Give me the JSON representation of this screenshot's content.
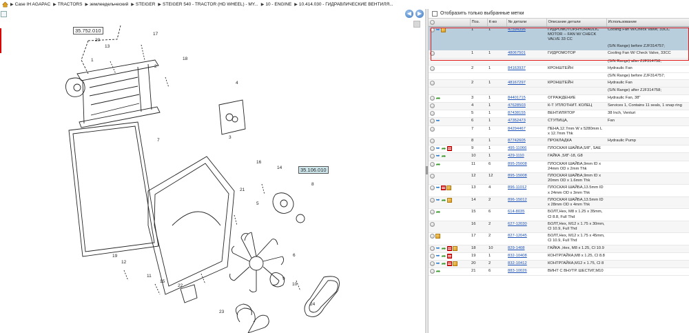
{
  "breadcrumb": [
    "Case IH AGAPAC",
    "TRACTORS",
    "землеедельческий",
    "STEIGER",
    "STEIGER 540 - TRACTOR (HD WHEEL) - MY...",
    "10 - ENGINE",
    "10.414.030 - ГИДРАВЛИЧЕСКИЕ ВЕНТИЛЯ..."
  ],
  "nav": {
    "back": "◀",
    "forward": "▶"
  },
  "filter_label": "Отобразить только выбранные метки",
  "diagram": {
    "ref_boxes": [
      "35.752.010",
      "35.106.010"
    ],
    "callouts": [
      "1",
      "2",
      "3",
      "4",
      "5",
      "6",
      "7",
      "8",
      "9",
      "10",
      "11",
      "12",
      "13",
      "14",
      "15",
      "16",
      "17",
      "18",
      "19",
      "20",
      "21",
      "22",
      "23",
      "24"
    ]
  },
  "table": {
    "headers": [
      "",
      "Поз.",
      "К-во",
      "№ детали",
      "Описание детали",
      "Использование"
    ],
    "rows": [
      {
        "icons": [
          "info",
          "arrow",
          "box"
        ],
        "pos": "1",
        "qty": "1",
        "part": "47594396",
        "desc": "ГИДРОМОТОР,HYDRAULIC MOTOR -- FAN W/ CHECK VALVE 33 CC",
        "usage": "Cooling Fan W/Check Valve, 33CC",
        "selected": true
      },
      {
        "sub": true,
        "usage": "(S/N Range) before ZJF314757;",
        "selected": true
      },
      {
        "icons": [
          "info"
        ],
        "pos": "1",
        "qty": "1",
        "part": "48067501",
        "desc": "ГИДРОМОТОР",
        "usage": "Cooling Fan W/ Check Valve, 33CC",
        "alt": true
      },
      {
        "sub": true,
        "usage": "(S/N Range) after ZJF314758;",
        "alt": true
      },
      {
        "icons": [
          "info"
        ],
        "pos": "2",
        "qty": "1",
        "part": "84163937",
        "desc": "КРОНШТЕЙН",
        "usage": "Hydraulic Fan"
      },
      {
        "sub": true,
        "usage": "(S/N Range) before ZJF314757;"
      },
      {
        "icons": [
          "info"
        ],
        "pos": "2",
        "qty": "1",
        "part": "48167297",
        "desc": "КРОНШТЕЙН",
        "usage": "Hydraulic Fan",
        "alt": true
      },
      {
        "sub": true,
        "usage": "(S/N Range) after ZJF314758;",
        "alt": true
      },
      {
        "icons": [
          "info",
          "green"
        ],
        "pos": "3",
        "qty": "1",
        "part": "84401715",
        "desc": "ОГРАЖДЕНИЕ",
        "usage": "Hydraulic Fan, 38\""
      },
      {
        "icons": [
          "info"
        ],
        "pos": "4",
        "qty": "1",
        "part": "47628503",
        "desc": "К-Т УПЛОТНИТ. КОЛЕЦ",
        "usage": "Services 1, Contains 11 seals, 1 snap ring",
        "alt": true
      },
      {
        "icons": [
          "info"
        ],
        "pos": "5",
        "qty": "1",
        "part": "87438155",
        "desc": "ВЕНТИЛЯТОР",
        "usage": "38 Inch, Venturi"
      },
      {
        "icons": [
          "info",
          "arrow"
        ],
        "pos": "6",
        "qty": "1",
        "part": "47352473",
        "desc": "СТУПИЦА,",
        "usage": "Fan",
        "alt": true
      },
      {
        "icons": [
          "info"
        ],
        "pos": "7",
        "qty": "1",
        "part": "84294467",
        "desc": "ПЕНА,12.7mm W x 5280mm L x 12.7mm Thk",
        "usage": ""
      },
      {
        "icons": [
          "info"
        ],
        "pos": "8",
        "qty": "1",
        "part": "87742605",
        "desc": "ПРОКЛАДКА",
        "usage": "Hydraulic Pump",
        "alt": true
      },
      {
        "icons": [
          "info",
          "arrow",
          "green",
          "redlist"
        ],
        "pos": "9",
        "qty": "1",
        "part": "495-11066",
        "desc": "ПЛОСКАЯ ШАЙБА,5/8\", SAE",
        "usage": ""
      },
      {
        "icons": [
          "info",
          "arrow",
          "green"
        ],
        "pos": "10",
        "qty": "1",
        "part": "429-1110",
        "desc": "ГАЙКА ,5/8\"-18, G8",
        "usage": "",
        "alt": true
      },
      {
        "icons": [
          "info",
          "green"
        ],
        "pos": "11",
        "qty": "6",
        "part": "895-25008",
        "desc": "ПЛОСКАЯ ШАЙБА,9mm ID x 24mm OD x 2mm Thk",
        "usage": ""
      },
      {
        "icons": [
          "info"
        ],
        "pos": "12",
        "qty": "12",
        "part": "895-15008",
        "desc": "ПЛОСКАЯ ШАЙБА,9mm ID x 20mm OD x 1.6mm Thk",
        "usage": "",
        "alt": true
      },
      {
        "icons": [
          "info",
          "arrow",
          "redlist",
          "box"
        ],
        "pos": "13",
        "qty": "4",
        "part": "896-11012",
        "desc": "ПЛОСКАЯ ШАЙБА,13.5mm ID x 24mm OD x 3mm Thk",
        "usage": ""
      },
      {
        "icons": [
          "info",
          "arrow",
          "green",
          "box"
        ],
        "pos": "14",
        "qty": "2",
        "part": "896-15012",
        "desc": "ПЛОСКАЯ ШАЙБА,13.5mm ID x 28mm OD x 4mm Thk",
        "usage": "",
        "alt": true
      },
      {
        "icons": [
          "info",
          "green"
        ],
        "pos": "15",
        "qty": "6",
        "part": "614-8035",
        "desc": "БОЛТ,Hex, M8 x 1.25 x 35mm, Cl 8.8, Full Thd",
        "usage": ""
      },
      {
        "icons": [
          "info"
        ],
        "pos": "16",
        "qty": "2",
        "part": "627-12030",
        "desc": "БОЛТ,Hex, M12 x 1.75 x 30mm, Cl 10.9, Full Thd",
        "usage": "",
        "alt": true
      },
      {
        "icons": [
          "info",
          "box"
        ],
        "pos": "17",
        "qty": "2",
        "part": "827-12045",
        "desc": "БОЛТ,Hex, M12 x 1.75 x 45mm, Cl 10.9, Full Thd",
        "usage": ""
      },
      {
        "icons": [
          "info",
          "arrow",
          "green",
          "redlist",
          "box"
        ],
        "pos": "18",
        "qty": "10",
        "part": "829-1408",
        "desc": "ГАЙКА ,Hex, M8 x 1.25, Cl 10.9",
        "usage": "",
        "alt": true
      },
      {
        "icons": [
          "info",
          "arrow",
          "green",
          "redlist"
        ],
        "pos": "19",
        "qty": "1",
        "part": "832-10408",
        "desc": "КОНТРГАЙКА,M8 x 1.25, Cl 8.8",
        "usage": ""
      },
      {
        "icons": [
          "info",
          "arrow",
          "green",
          "redlist",
          "box"
        ],
        "pos": "20",
        "qty": "2",
        "part": "832-10412",
        "desc": "КОНТРГАЙКА,M12 x 1.75, Cl 8",
        "usage": "",
        "alt": true
      },
      {
        "icons": [
          "info",
          "green"
        ],
        "pos": "21",
        "qty": "6",
        "part": "883-10026",
        "desc": "ВИНТ С ВНУТР. ШЕСТИГ,M10",
        "usage": ""
      }
    ]
  }
}
